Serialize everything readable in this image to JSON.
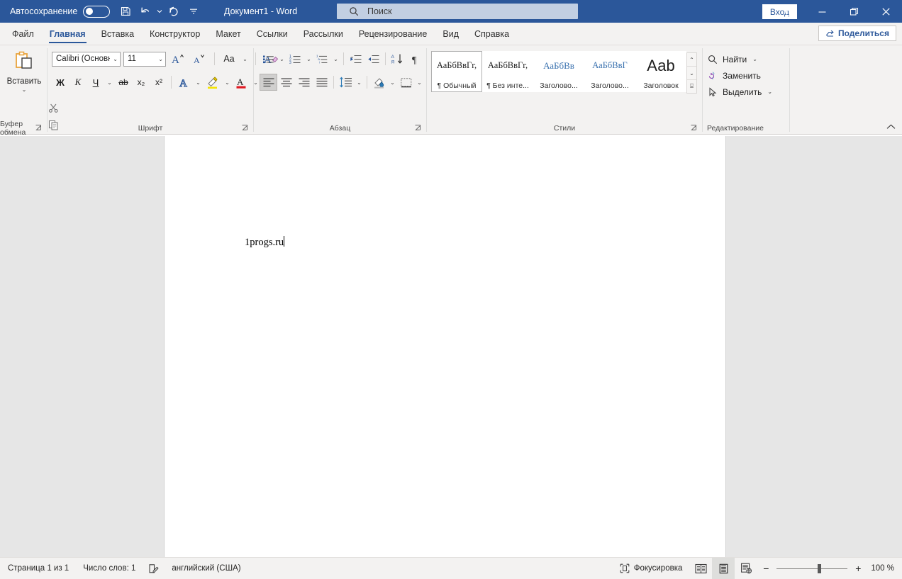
{
  "titlebar": {
    "autosave_label": "Автосохранение",
    "autosave_state": "off",
    "save_icon": "save-icon",
    "undo_icon": "undo-icon",
    "redo_icon": "redo-icon",
    "customize_qat_icon": "customize-quick-access-toolbar-icon",
    "document_title": "Документ1  -  Word",
    "search_placeholder": "Поиск",
    "search_icon": "search-icon",
    "signin_label": "Вход",
    "ribbon_display_icon": "ribbon-display-options-icon",
    "minimize_icon": "minimize-icon",
    "restore_icon": "restore-icon",
    "close_icon": "close-icon",
    "bg_color": "#2b579a"
  },
  "tabs": [
    {
      "label": "Файл",
      "active": false
    },
    {
      "label": "Главная",
      "active": true
    },
    {
      "label": "Вставка",
      "active": false
    },
    {
      "label": "Конструктор",
      "active": false
    },
    {
      "label": "Макет",
      "active": false
    },
    {
      "label": "Ссылки",
      "active": false
    },
    {
      "label": "Рассылки",
      "active": false
    },
    {
      "label": "Рецензирование",
      "active": false
    },
    {
      "label": "Вид",
      "active": false
    },
    {
      "label": "Справка",
      "active": false
    }
  ],
  "share": {
    "label": "Поделиться",
    "icon": "share-icon"
  },
  "ribbon": {
    "collapse_icon": "collapse-ribbon-chevron-icon",
    "clipboard": {
      "group_label": "Буфер обмена",
      "paste_label": "Вставить",
      "paste_icon": "paste-icon",
      "cut_icon": "cut-scissors-icon",
      "copy_icon": "copy-icon",
      "format_painter_icon": "format-painter-brush-icon",
      "dialog_launcher_icon": "dialog-launcher-icon"
    },
    "font": {
      "group_label": "Шрифт",
      "font_name": "Calibri (Основн",
      "font_size": "11",
      "grow_font_icon": "grow-font-icon",
      "shrink_font_icon": "shrink-font-icon",
      "change_case_label": "Aa",
      "clear_formatting_icon": "clear-formatting-icon",
      "bold_label": "Ж",
      "italic_label": "К",
      "underline_label": "Ч",
      "strikethrough_label": "ab",
      "subscript_label": "x₂",
      "superscript_label": "x²",
      "text_effects_label": "A",
      "highlight_label": "highlight-pen-icon",
      "font_color_label": "A",
      "dialog_launcher_icon": "dialog-launcher-icon"
    },
    "paragraph": {
      "group_label": "Абзац",
      "bullets_icon": "bulleted-list-icon",
      "numbering_icon": "numbered-list-icon",
      "multilevel_icon": "multilevel-list-icon",
      "decrease_indent_icon": "decrease-indent-icon",
      "increase_indent_icon": "increase-indent-icon",
      "sort_icon": "sort-icon",
      "show_marks_icon": "show-formatting-marks-icon",
      "align_left_icon": "align-left-icon",
      "align_center_icon": "align-center-icon",
      "align_right_icon": "align-right-icon",
      "justify_icon": "justify-icon",
      "line_spacing_icon": "line-spacing-icon",
      "shading_icon": "shading-icon",
      "borders_icon": "borders-icon",
      "dialog_launcher_icon": "dialog-launcher-icon"
    },
    "styles": {
      "group_label": "Стили",
      "dialog_launcher_icon": "dialog-launcher-icon",
      "scroll_up_icon": "scroll-up-icon",
      "scroll_down_icon": "scroll-down-icon",
      "more_styles_icon": "more-styles-icon",
      "items": [
        {
          "preview": "АаБбВвГг,",
          "caption": "¶ Обычный",
          "selected": true,
          "color": "dark",
          "size": "normal"
        },
        {
          "preview": "АаБбВвГг,",
          "caption": "¶ Без инте...",
          "selected": false,
          "color": "dark",
          "size": "normal"
        },
        {
          "preview": "АаБбВв",
          "caption": "Заголово...",
          "selected": false,
          "color": "blue",
          "size": "h1"
        },
        {
          "preview": "АаБбВвГ",
          "caption": "Заголово...",
          "selected": false,
          "color": "blue",
          "size": "normal"
        },
        {
          "preview": "Ааb",
          "caption": "Заголовок",
          "selected": false,
          "color": "dark",
          "size": "big"
        }
      ]
    },
    "editing": {
      "group_label": "Редактирование",
      "find_label": "Найти",
      "find_icon": "find-magnifier-icon",
      "replace_label": "Заменить",
      "replace_icon": "replace-icon",
      "select_label": "Выделить",
      "select_icon": "select-pointer-icon",
      "dialog_launcher_icon": "dialog-launcher-icon"
    }
  },
  "document": {
    "body_text": "1progs.ru"
  },
  "statusbar": {
    "page_info": "Страница 1 из 1",
    "word_count": "Число слов: 1",
    "proofing_icon": "proofing-errors-icon",
    "language": "английский (США)",
    "focus_label": "Фокусировка",
    "focus_icon": "focus-mode-icon",
    "read_mode_icon": "read-mode-icon",
    "print_layout_icon": "print-layout-icon",
    "web_layout_icon": "web-layout-icon",
    "zoom_out_label": "−",
    "zoom_in_label": "+",
    "zoom_level": "100 %"
  }
}
